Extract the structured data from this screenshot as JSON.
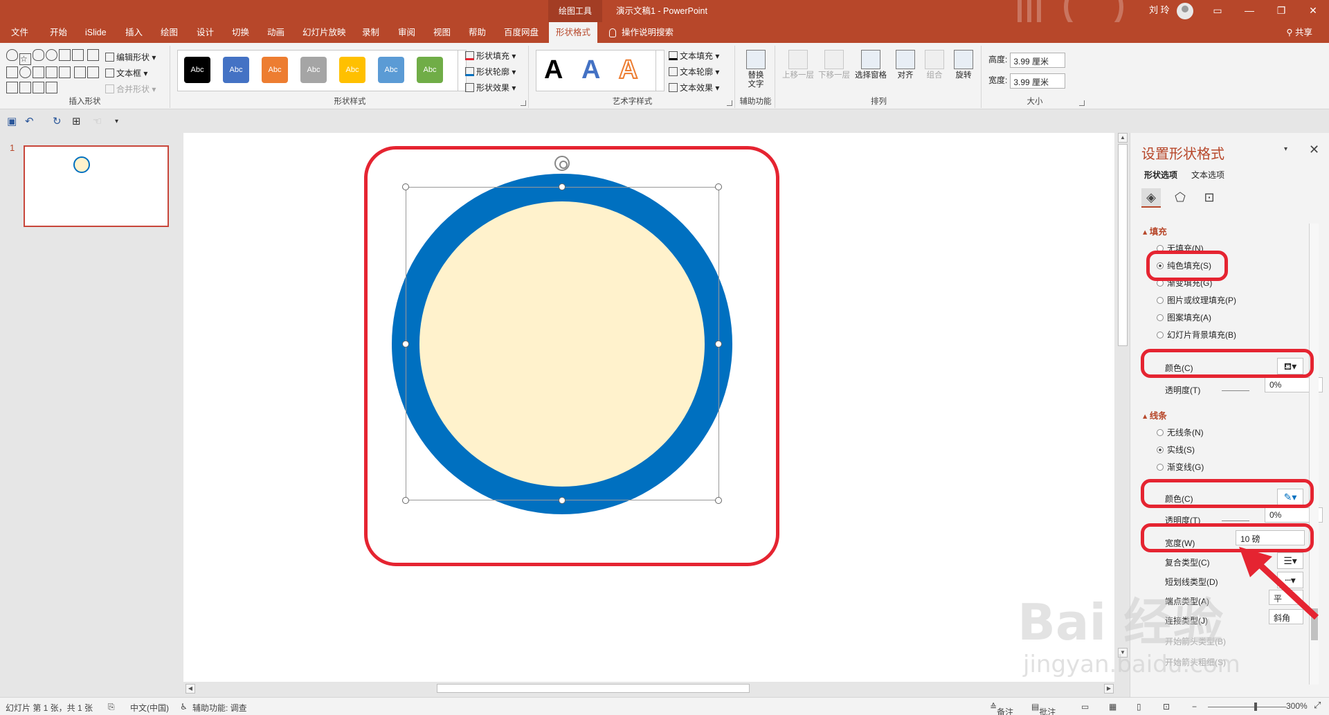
{
  "titlebar": {
    "context_tab": "绘图工具",
    "doc_title": "演示文稿1  -  PowerPoint",
    "user": "刘 玲"
  },
  "tabs": [
    "文件",
    "开始",
    "iSlide",
    "插入",
    "绘图",
    "设计",
    "切换",
    "动画",
    "幻灯片放映",
    "录制",
    "审阅",
    "视图",
    "帮助",
    "百度网盘",
    "形状格式",
    "操作说明搜索"
  ],
  "share": "共享",
  "ribbon": {
    "insert_shapes": {
      "label": "插入形状",
      "edit_shape": "编辑形状",
      "text_box": "文本框",
      "merge_shapes": "合并形状"
    },
    "shape_styles": {
      "label": "形状样式",
      "swatches": [
        {
          "text": "Abc",
          "color": "#000000"
        },
        {
          "text": "Abc",
          "color": "#4472c4"
        },
        {
          "text": "Abc",
          "color": "#ed7d31"
        },
        {
          "text": "Abc",
          "color": "#a5a5a5"
        },
        {
          "text": "Abc",
          "color": "#ffc000"
        },
        {
          "text": "Abc",
          "color": "#5b9bd5"
        },
        {
          "text": "Abc",
          "color": "#70ad47"
        }
      ],
      "fill": "形状填充",
      "outline": "形状轮廓",
      "effects": "形状效果"
    },
    "wordart": {
      "label": "艺术字样式",
      "letter": "A",
      "text_fill": "文本填充",
      "text_outline": "文本轮廓",
      "text_effects": "文本效果"
    },
    "accessibility": {
      "label": "辅助功能",
      "alt_text": "替换\n文字"
    },
    "arrange": {
      "label": "排列",
      "bring_forward": "上移一层",
      "send_backward": "下移一层",
      "selection_pane": "选择窗格",
      "align": "对齐",
      "group": "组合",
      "rotate": "旋转"
    },
    "size": {
      "label": "大小",
      "height_label": "高度:",
      "height": "3.99 厘米",
      "width_label": "宽度:",
      "width": "3.99 厘米"
    }
  },
  "slides": {
    "number": "1"
  },
  "pane": {
    "title": "设置形状格式",
    "tab_shape": "形状选项",
    "tab_text": "文本选项",
    "fill_section": "填充",
    "fill_options": [
      "无填充(N)",
      "纯色填充(S)",
      "渐变填充(G)",
      "图片或纹理填充(P)",
      "图案填充(A)",
      "幻灯片背景填充(B)"
    ],
    "fill_color_label": "颜色(C)",
    "fill_transparency_label": "透明度(T)",
    "fill_transparency": "0%",
    "line_section": "线条",
    "line_options": [
      "无线条(N)",
      "实线(S)",
      "渐变线(G)"
    ],
    "line_color_label": "颜色(C)",
    "line_transparency_label": "透明度(T)",
    "line_transparency": "0%",
    "width_label": "宽度(W)",
    "width_value": "10 磅",
    "compound_label": "复合类型(C)",
    "dash_label": "短划线类型(D)",
    "cap_label": "端点类型(A)",
    "cap_value": "平",
    "join_label": "连接类型(J)",
    "join_value": "斜角",
    "begin_arrow_label": "开始箭头类型(B)",
    "begin_arrow_size_label": "开始箭头粗细(S)"
  },
  "status": {
    "slide_info": "幻灯片 第 1 张，共 1 张",
    "language": "中文(中国)",
    "accessibility": "辅助功能: 调查",
    "notes": "备注",
    "comments": "批注",
    "zoom": "300%"
  },
  "colors": {
    "accent": "#b7472a",
    "shape_fill": "#fff2cc",
    "shape_outline": "#0070c0",
    "annotation": "#e52431"
  },
  "watermark": {
    "text": "Bai 经验",
    "url": "jingyan.baidu.com"
  }
}
